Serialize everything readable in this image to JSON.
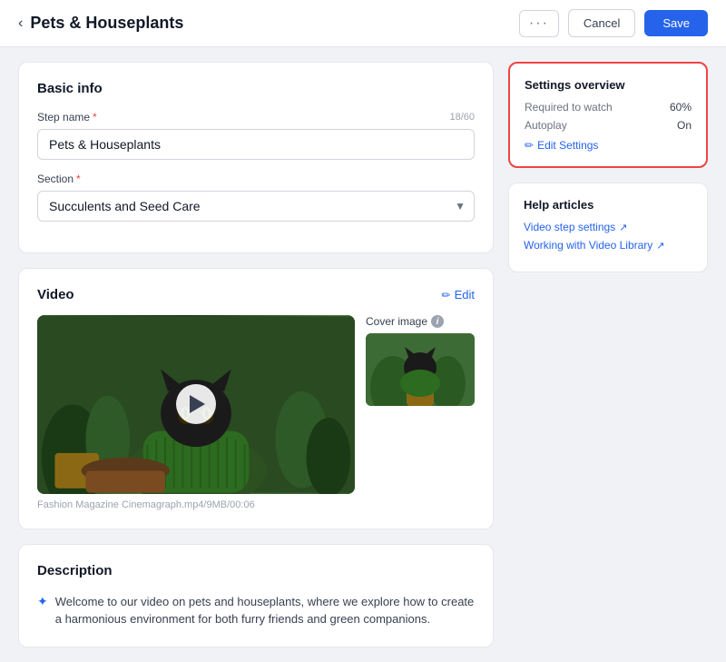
{
  "header": {
    "title": "Pets & Houseplants",
    "back_label": "‹",
    "more_label": "···",
    "cancel_label": "Cancel",
    "save_label": "Save"
  },
  "basic_info": {
    "section_title": "Basic info",
    "step_name_label": "Step name",
    "step_name_required": "*",
    "step_name_value": "Pets & Houseplants",
    "step_name_char_count": "18/60",
    "section_label": "Section",
    "section_required": "*",
    "section_value": "Succulents and Seed Care"
  },
  "video": {
    "section_title": "Video",
    "edit_label": "Edit",
    "edit_icon": "✏",
    "video_meta": "Fashion Magazine Cinemagraph.mp4/9MB/00:06",
    "cover_image_label": "Cover image",
    "info_icon": "i"
  },
  "description": {
    "section_title": "Description",
    "bullet_icon": "✦",
    "text": "Welcome to our video on pets and houseplants, where we explore how to create a harmonious environment for both furry friends and green companions."
  },
  "settings_overview": {
    "title": "Settings overview",
    "border_color": "#ef4444",
    "required_to_watch_label": "Required to watch",
    "required_to_watch_value": "60%",
    "autoplay_label": "Autoplay",
    "autoplay_value": "On",
    "edit_settings_label": "Edit Settings",
    "edit_icon": "✏"
  },
  "help_articles": {
    "title": "Help articles",
    "links": [
      {
        "label": "Video step settings",
        "icon": "↗"
      },
      {
        "label": "Working with Video Library",
        "icon": "↗"
      }
    ]
  }
}
